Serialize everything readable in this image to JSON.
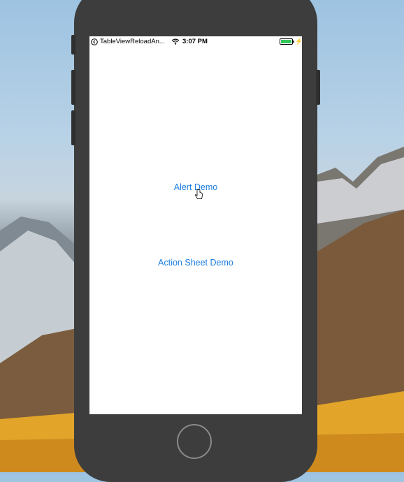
{
  "status_bar": {
    "back_app_label": "TableViewReloadAn...",
    "time": "3:07 PM",
    "back_icon": "back-arrow-icon",
    "wifi_icon": "wifi-icon",
    "battery_icon": "battery-icon",
    "battery_level": 1.0,
    "battery_color": "#34c759",
    "charging_icon": "bolt-icon"
  },
  "buttons": {
    "alert_demo": "Alert Demo",
    "action_sheet_demo": "Action Sheet Demo"
  },
  "colors": {
    "link": "#1e7fe0",
    "device": "#3d3d3d"
  }
}
